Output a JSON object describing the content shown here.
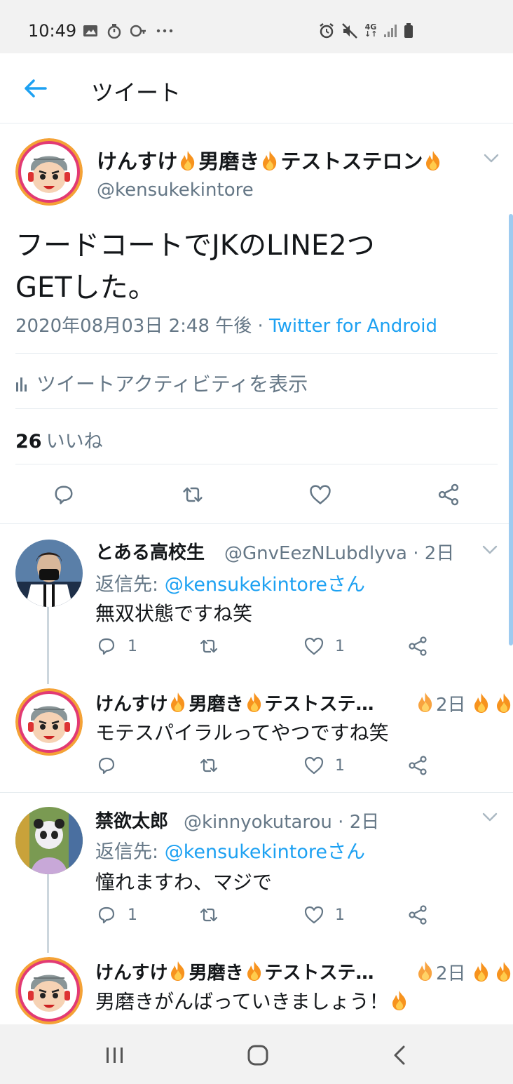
{
  "status_bar": {
    "time": "10:49",
    "left_icons": [
      "gallery-icon",
      "stopwatch-icon",
      "key-icon",
      "more-dots-icon"
    ],
    "right_icons": [
      "alarm-icon",
      "mute-icon",
      "4g-data-icon",
      "signal-icon",
      "battery-icon"
    ],
    "network_label": "4G"
  },
  "app_bar": {
    "title": "ツイート"
  },
  "main_tweet": {
    "name_parts": [
      "けんすけ",
      "男磨き",
      "テストステロン"
    ],
    "handle": "@kensukekintore",
    "text_line1": "フードコートでJKのLINE2つ",
    "text_line2": "GETした。",
    "timestamp": "2020年08月03日 2:48 午後 · ",
    "source": "Twitter for Android",
    "activity_label": "ツイートアクティビティを表示",
    "likes_count": "26",
    "likes_label": "いいね"
  },
  "replies": [
    {
      "name": "とある高校生",
      "handle_time": "@GnvEezNLubdlyva · 2日",
      "reply_to_prefix": "返信先: ",
      "reply_to_link": "@kensukekintoreさん",
      "text": "無双状態ですね笑",
      "reply_count": "1",
      "like_count": "1"
    },
    {
      "name_parts": [
        "けんすけ",
        "男磨き",
        "テストステ…"
      ],
      "time": "2日",
      "text": "モテスパイラルってやつですね笑",
      "reply_count": "",
      "like_count": "1"
    },
    {
      "name": "禁欲太郎",
      "handle_time": "@kinnyokutarou · 2日",
      "reply_to_prefix": "返信先: ",
      "reply_to_link": "@kensukekintoreさん",
      "text": "憧れますわ、マジで",
      "reply_count": "1",
      "like_count": "1"
    },
    {
      "name_parts": [
        "けんすけ",
        "男磨き",
        "テストステ…"
      ],
      "time": "2日",
      "text": "男磨きがんばっていきましょう！"
    }
  ],
  "colors": {
    "accent": "#1da1f2",
    "muted": "#657786",
    "text": "#14171a",
    "divider": "#e6ecf0",
    "fire": "#f7931e"
  },
  "nav_bar": {
    "icons": [
      "recent-apps-icon",
      "home-icon",
      "back-icon"
    ]
  }
}
